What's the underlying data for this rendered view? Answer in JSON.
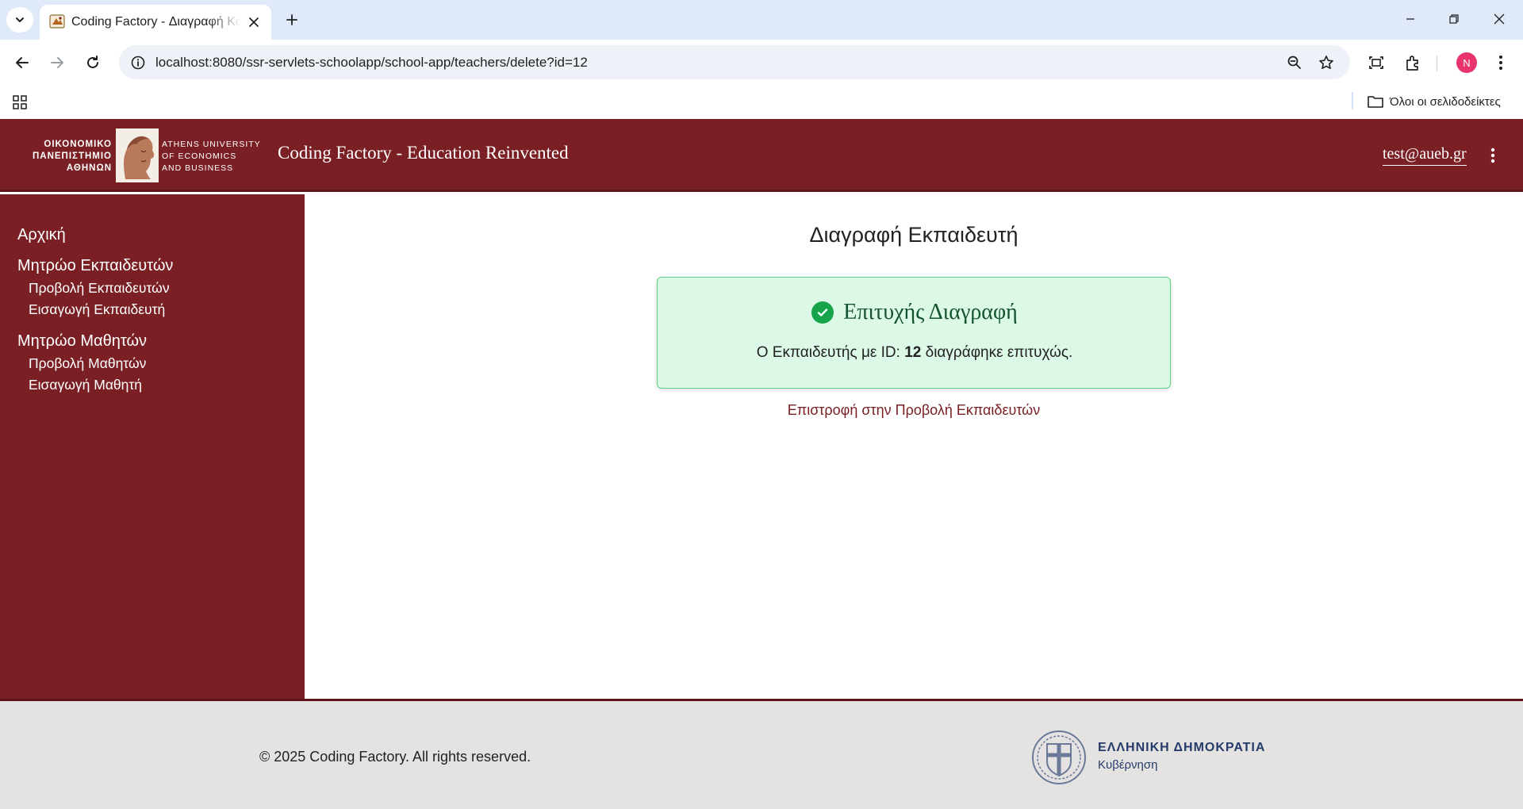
{
  "browser": {
    "tab_title": "Coding Factory - Διαγραφή Καθηγητή",
    "url": "localhost:8080/ssr-servlets-schoolapp/school-app/teachers/delete?id=12",
    "profile_initial": "N",
    "bookmarks_all": "Όλοι οι σελιδοδείκτες",
    "icons": [
      "tab-search-icon",
      "close-icon",
      "plus-icon",
      "minimize-icon",
      "restore-icon",
      "back-arrow-icon",
      "forward-arrow-icon",
      "reload-icon",
      "site-info-icon",
      "zoom-icon",
      "star-icon",
      "cast-icon",
      "extensions-icon",
      "more-vert-icon",
      "apps-grid-icon",
      "folder-icon"
    ]
  },
  "header": {
    "logo_greek": [
      "ΟΙΚΟΝΟΜΙΚΟ",
      "ΠΑΝΕΠΙΣΤΗΜΙΟ",
      "ΑΘΗΝΩΝ"
    ],
    "logo_english": [
      "ATHENS UNIVERSITY",
      "OF ECONOMICS",
      "AND BUSINESS"
    ],
    "site_title": "Coding Factory - Education Reinvented",
    "user_email": "test@aueb.gr"
  },
  "sidebar": {
    "home": "Αρχική",
    "teachers_section": "Μητρώο Εκπαιδευτών",
    "view_teachers": "Προβολή Εκπαιδευτών",
    "insert_teacher": "Εισαγωγή Εκπαιδευτή",
    "students_section": "Μητρώο Μαθητών",
    "view_students": "Προβολή Μαθητών",
    "insert_student": "Εισαγωγή Μαθητή"
  },
  "main": {
    "heading": "Διαγραφή Εκπαιδευτή",
    "alert_title": "Επιτυχής Διαγραφή",
    "alert_msg_prefix": "Ο Εκπαιδευτής με ID:",
    "deleted_id": "12",
    "alert_msg_suffix": "διαγράφηκε επιτυχώς.",
    "back_link": "Επιστροφή στην Προβολή Εκπαιδευτών",
    "success_color": "#16a34a"
  },
  "footer": {
    "copyright": "© 2025 Coding Factory. All rights reserved.",
    "gov_name": "ΕΛΛΗΝΙΚΗ ΔΗΜΟΚΡΑΤΙΑ",
    "gov_sub": "Κυβέρνηση"
  },
  "colors": {
    "brand": "#7a2025",
    "alert_bg": "#dcf8e6",
    "footer_bg": "#e4e3e1",
    "gov_text": "#243b6b"
  }
}
